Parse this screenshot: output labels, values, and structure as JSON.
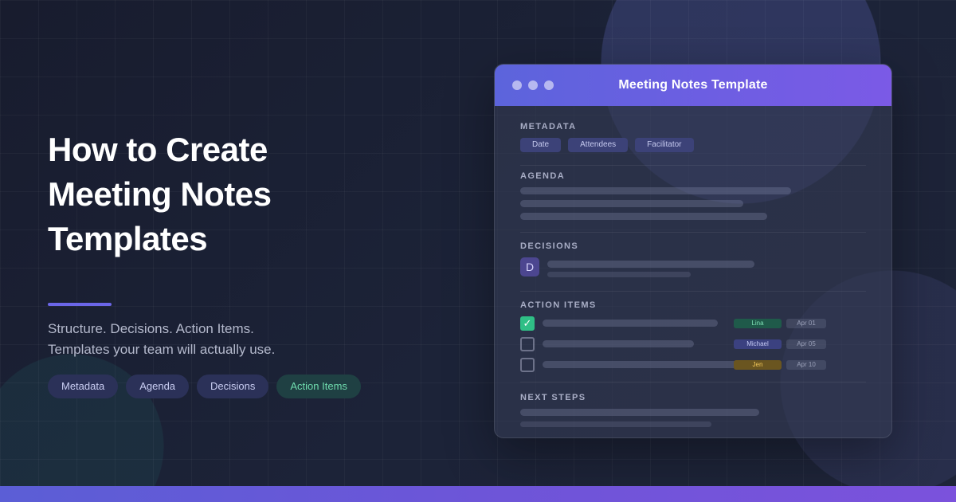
{
  "hero": {
    "title_lines": [
      "How to Create",
      "Meeting Notes",
      "Templates"
    ],
    "subtitle_lines": [
      "Structure. Decisions. Action Items.",
      "Templates your team will actually use."
    ],
    "tags": [
      {
        "label": "Metadata",
        "style": "default"
      },
      {
        "label": "Agenda",
        "style": "default"
      },
      {
        "label": "Decisions",
        "style": "default"
      },
      {
        "label": "Action Items",
        "style": "green"
      }
    ]
  },
  "card": {
    "title": "Meeting Notes Template",
    "window_controls": [
      "dot-icon",
      "dot-icon",
      "dot-icon"
    ],
    "sections": {
      "metadata": {
        "label": "METADATA",
        "tags": [
          "Date",
          "Attendees",
          "Facilitator"
        ]
      },
      "agenda": {
        "label": "AGENDA"
      },
      "decisions": {
        "label": "DECISIONS",
        "badge": "D"
      },
      "action_items": {
        "label": "ACTION ITEMS",
        "items": [
          {
            "checked": true,
            "assignee": "Lina",
            "assignee_color": "green",
            "due": "Apr 01"
          },
          {
            "checked": false,
            "assignee": "Michael",
            "assignee_color": "blue",
            "due": "Apr 05"
          },
          {
            "checked": false,
            "assignee": "Jen",
            "assignee_color": "yellow",
            "due": "Apr 10"
          }
        ]
      },
      "next_steps": {
        "label": "NEXT STEPS"
      }
    }
  },
  "colors": {
    "background": "#1a1f33",
    "accent": "#6b66e8",
    "header_gradient_start": "#5c64dc",
    "header_gradient_end": "#7b5ae6",
    "success": "#2fbf86"
  },
  "icons": {
    "checkbox_checked": "check-icon"
  }
}
